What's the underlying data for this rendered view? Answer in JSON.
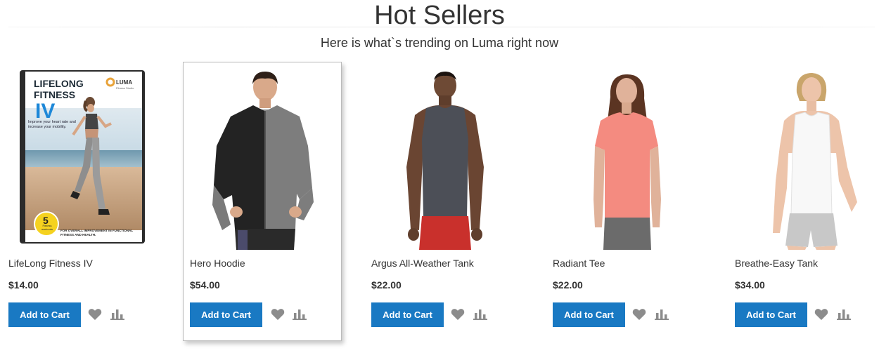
{
  "section": {
    "title": "Hot Sellers",
    "subtitle": "Here is what`s trending on Luma right now"
  },
  "colors": {
    "button": "#1979c3",
    "icon": "#8c8c8c"
  },
  "dvd_cover": {
    "title_line1": "LIFELONG",
    "title_line2": "FITNESS",
    "title_line3": "IV",
    "brand": "LUMA",
    "brand_sub": "Fitness Studio",
    "tagline": "Improve your heart rate and increase your mobility.",
    "badge_number": "5",
    "badge_text": "Fitness workouts",
    "footer": "FOR OVERALL IMPROVEMENT IN FUNCTIONAL FITNESS AND HEALTH."
  },
  "products": [
    {
      "name": "LifeLong Fitness IV",
      "price": "$14.00",
      "add_to_cart": "Add to Cart",
      "wishlist_icon": "heart-icon",
      "compare_icon": "bar-chart-icon"
    },
    {
      "name": "Hero Hoodie",
      "price": "$54.00",
      "add_to_cart": "Add to Cart",
      "wishlist_icon": "heart-icon",
      "compare_icon": "bar-chart-icon"
    },
    {
      "name": "Argus All-Weather Tank",
      "price": "$22.00",
      "add_to_cart": "Add to Cart",
      "wishlist_icon": "heart-icon",
      "compare_icon": "bar-chart-icon"
    },
    {
      "name": "Radiant Tee",
      "price": "$22.00",
      "add_to_cart": "Add to Cart",
      "wishlist_icon": "heart-icon",
      "compare_icon": "bar-chart-icon"
    },
    {
      "name": "Breathe-Easy Tank",
      "price": "$34.00",
      "add_to_cart": "Add to Cart",
      "wishlist_icon": "heart-icon",
      "compare_icon": "bar-chart-icon"
    }
  ]
}
